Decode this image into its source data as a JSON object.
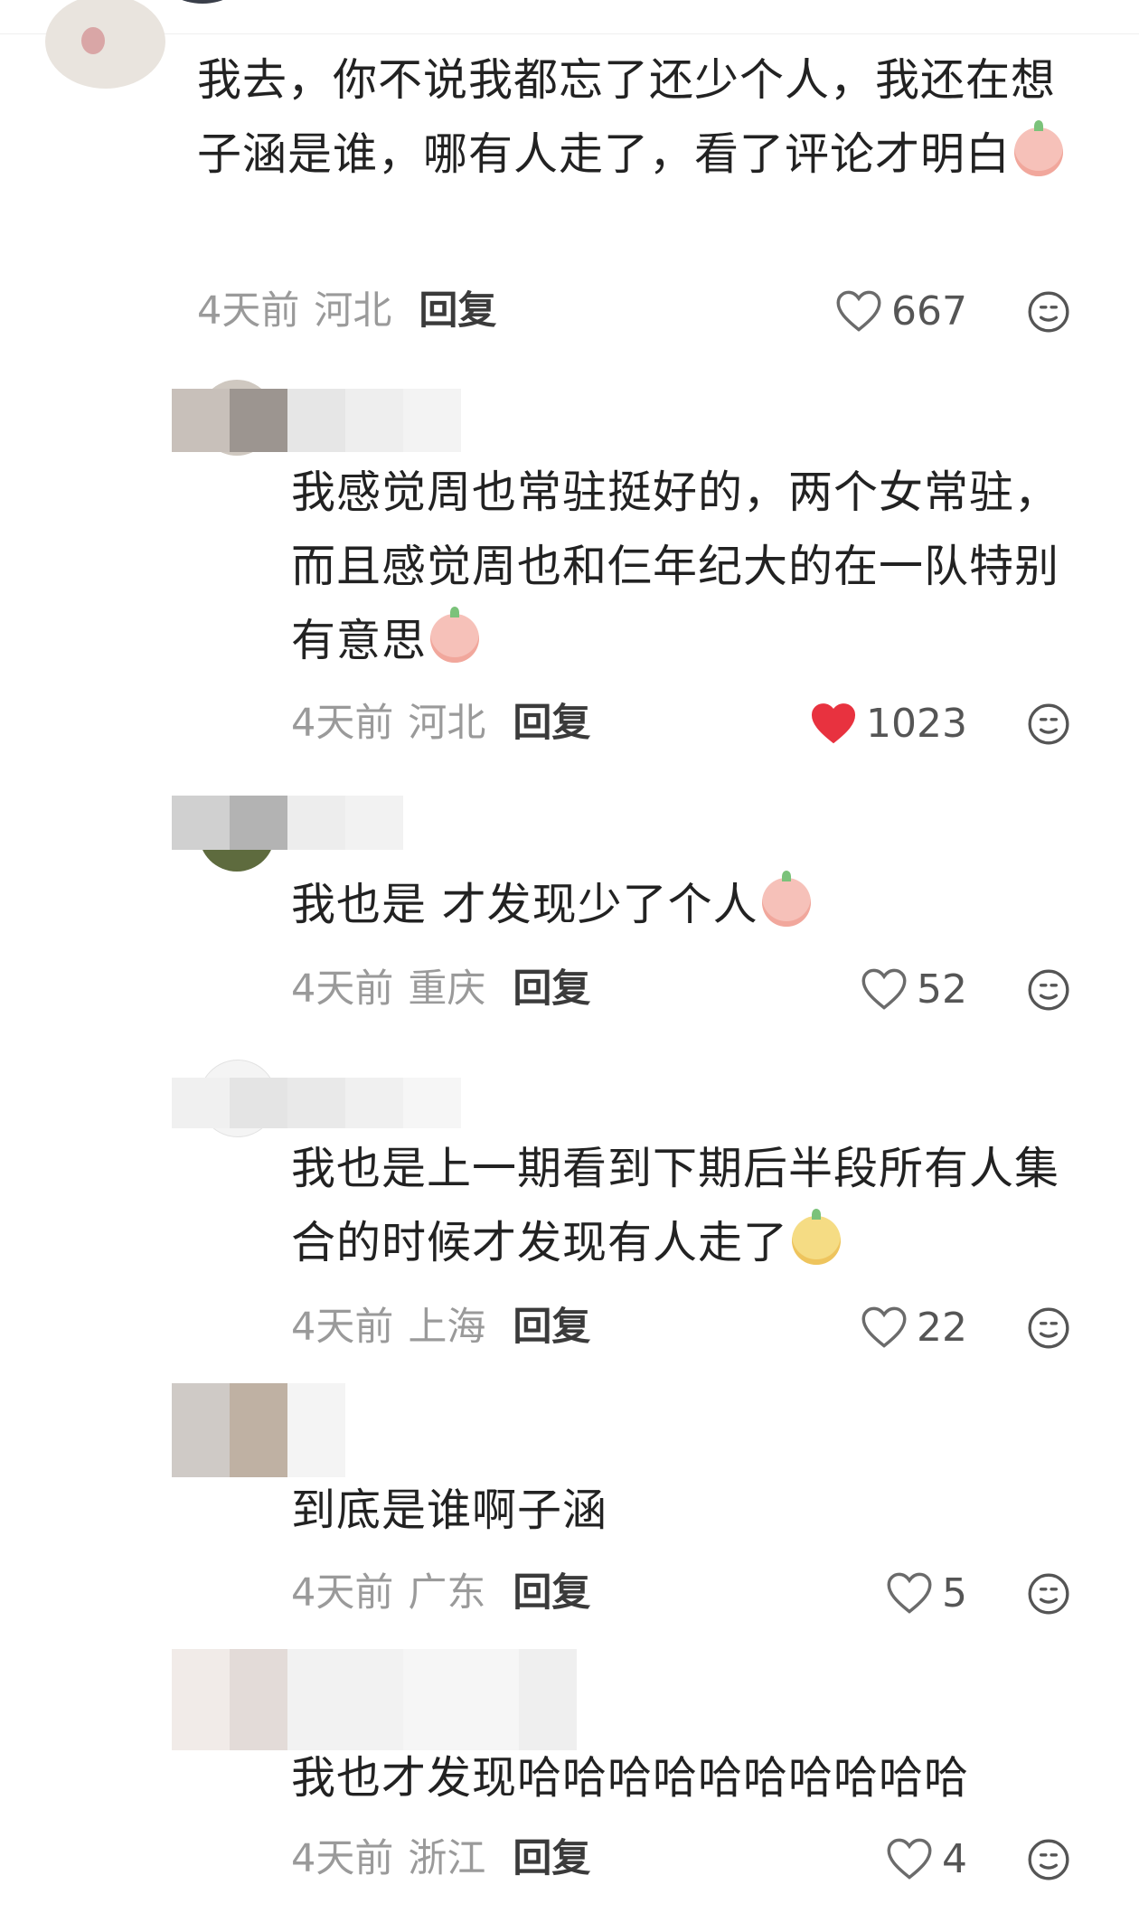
{
  "comments": [
    {
      "text": "我去，你不说我都忘了还少个人，我还在想子涵是谁，哪有人走了，看了评论才明白",
      "time": "4天前",
      "location": "河北",
      "reply_label": "回复",
      "likes": "667",
      "liked": false,
      "emoji": "crying-laugh-emoji"
    },
    {
      "text": "我感觉周也常驻挺好的，两个女常驻，而且感觉周也和仨年纪大的在一队特别有意思",
      "time": "4天前",
      "location": "河北",
      "reply_label": "回复",
      "likes": "1023",
      "liked": true,
      "emoji": "shy-emoji"
    },
    {
      "text": "我也是 才发现少了个人",
      "time": "4天前",
      "location": "重庆",
      "reply_label": "回复",
      "likes": "52",
      "liked": false,
      "emoji": "smile-emoji"
    },
    {
      "text": "我也是上一期看到下期后半段所有人集合的时候才发现有人走了",
      "time": "4天前",
      "location": "上海",
      "reply_label": "回复",
      "likes": "22",
      "liked": false,
      "emoji": "surprised-emoji"
    },
    {
      "text": "到底是谁啊子涵",
      "time": "4天前",
      "location": "广东",
      "reply_label": "回复",
      "likes": "5",
      "liked": false
    },
    {
      "text": "我也才发现哈哈哈哈哈哈哈哈哈哈",
      "time": "4天前",
      "location": "浙江",
      "reply_label": "回复",
      "likes": "4",
      "liked": false
    }
  ],
  "colors": {
    "liked_heart": "#e8323f",
    "meta": "#9a9a9a"
  },
  "icons": {
    "like": "heart-icon",
    "emoji_reaction": "smiley-icon"
  }
}
